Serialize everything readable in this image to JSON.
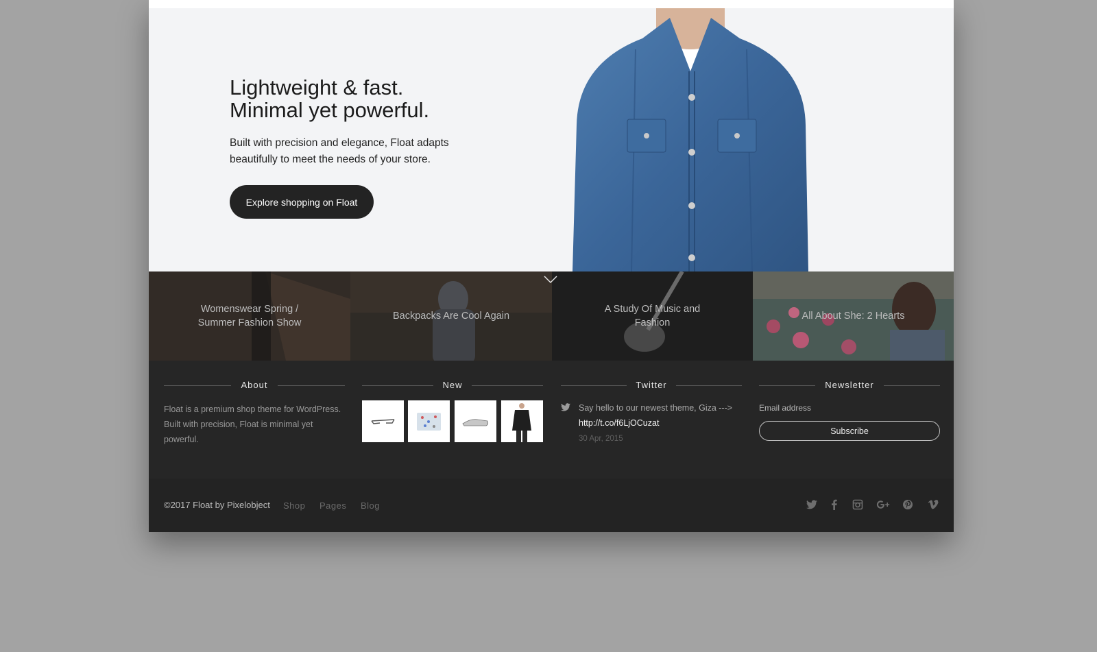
{
  "hero": {
    "title_line1": "Lightweight & fast.",
    "title_line2": "Minimal yet powerful.",
    "description": "Built with precision and elegance, Float adapts beautifully to meet the needs of your store.",
    "cta_label": "Explore shopping on Float"
  },
  "posts": [
    {
      "title": "Womenswear Spring / Summer Fashion Show"
    },
    {
      "title": "Backpacks Are Cool Again"
    },
    {
      "title": "A Study Of Music and Fashion"
    },
    {
      "title": "All About She: 2 Hearts"
    }
  ],
  "footer": {
    "about": {
      "heading": "About",
      "text": "Float is a premium shop theme for WordPress. Built with precision, Float is minimal yet powerful."
    },
    "new": {
      "heading": "New",
      "products": [
        "sunglasses",
        "printed pouch",
        "silver sneaker",
        "leather jacket"
      ]
    },
    "twitter": {
      "heading": "Twitter",
      "tweet_text": "Say hello to our newest theme, Giza --->",
      "tweet_link": "http://t.co/f6LjOCuzat",
      "date": "30 Apr, 2015"
    },
    "newsletter": {
      "heading": "Newsletter",
      "email_label": "Email address",
      "subscribe_label": "Subscribe"
    }
  },
  "bottom_bar": {
    "copyright": "©2017 Float by Pixelobject",
    "nav": [
      "Shop",
      "Pages",
      "Blog"
    ],
    "social_icons": [
      "twitter-icon",
      "facebook-icon",
      "instagram-icon",
      "google-plus-icon",
      "pinterest-icon",
      "vimeo-icon"
    ]
  },
  "colors": {
    "page_background": "#a3a3a3",
    "hero_background": "#f3f4f6",
    "footer_background": "#262626",
    "button_dark": "#232323"
  }
}
